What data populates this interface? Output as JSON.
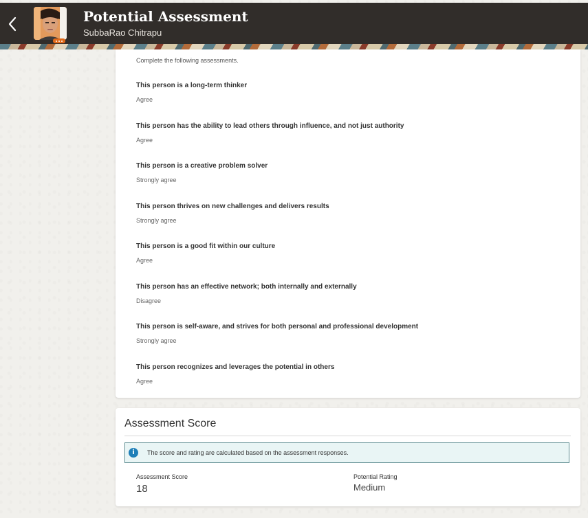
{
  "header": {
    "title": "Potential Assessment",
    "subtitle": "SubbaRao Chitrapu",
    "back_icon": "chevron-left-icon",
    "colors": {
      "bar": "#312d2a",
      "title": "#ffffff"
    }
  },
  "assessments": {
    "instructions": "Complete the following assessments.",
    "questions": [
      {
        "text": "This person is a long-term thinker",
        "answer": "Agree"
      },
      {
        "text": "This person has the ability to lead others through influence, and not just authority",
        "answer": "Agree"
      },
      {
        "text": "This person is a creative problem solver",
        "answer": "Strongly agree"
      },
      {
        "text": "This person thrives on new challenges and delivers results",
        "answer": "Strongly agree"
      },
      {
        "text": "This person is a good fit within our culture",
        "answer": "Agree"
      },
      {
        "text": "This person has an effective network; both internally and externally",
        "answer": "Disagree"
      },
      {
        "text": "This person is self-aware, and strives for both personal and professional development",
        "answer": "Strongly agree"
      },
      {
        "text": "This person recognizes and leverages the potential in others",
        "answer": "Agree"
      }
    ]
  },
  "score": {
    "title": "Assessment Score",
    "info_text": "The score and rating are calculated based on the assessment responses.",
    "info_icon": "info-icon",
    "score_label": "Assessment Score",
    "score_value": "18",
    "rating_label": "Potential Rating",
    "rating_value": "Medium",
    "colors": {
      "info_bg": "#e9f5f5",
      "info_border": "#5b8a8f",
      "info_icon": "#1f7fb8"
    }
  }
}
